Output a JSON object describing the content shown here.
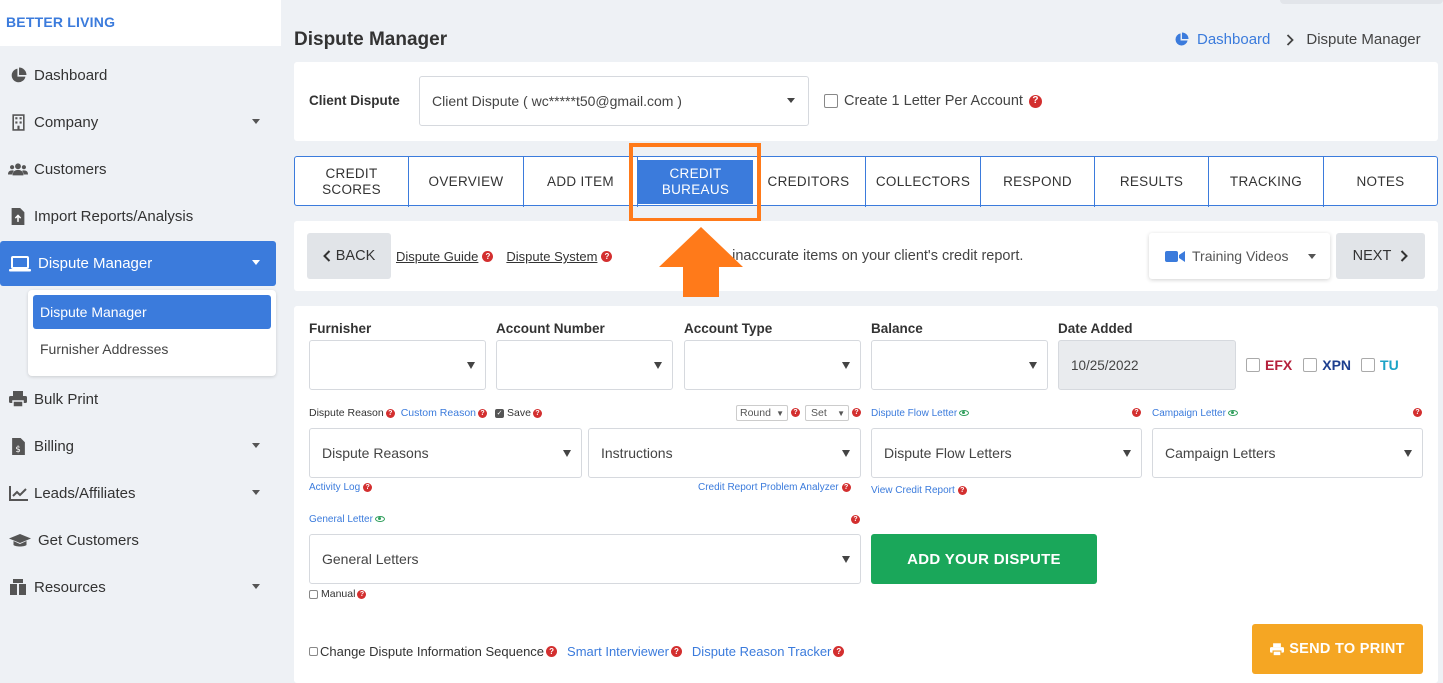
{
  "brand": "BETTER LIVING",
  "nav": [
    {
      "label": "Dashboard",
      "icon": "pie-chart-icon"
    },
    {
      "label": "Company",
      "icon": "building-icon"
    },
    {
      "label": "Customers",
      "icon": "users-icon"
    },
    {
      "label": "Import Reports/Analysis",
      "icon": "file-import-icon"
    },
    {
      "label": "Dispute Manager",
      "icon": "laptop-icon"
    },
    {
      "label": "Bulk Print",
      "icon": "printer-icon"
    },
    {
      "label": "Billing",
      "icon": "invoice-icon"
    },
    {
      "label": "Leads/Affiliates",
      "icon": "chart-line-icon"
    },
    {
      "label": "Get Customers",
      "icon": "graduation-cap-icon"
    },
    {
      "label": "Resources",
      "icon": "box-icon"
    }
  ],
  "submenu": [
    "Dispute Manager",
    "Furnisher Addresses"
  ],
  "page": {
    "title": "Dispute Manager",
    "breadcrumb": {
      "home": "Dashboard",
      "current": "Dispute Manager"
    }
  },
  "client": {
    "label": "Client Dispute",
    "value": "Client Dispute ( wc*****t50@gmail.com )",
    "one_letter": "Create 1 Letter Per Account"
  },
  "tabs": [
    {
      "l1": "CREDIT",
      "l2": "SCORES"
    },
    {
      "l1": "OVERVIEW",
      "l2": ""
    },
    {
      "l1": "ADD ITEM",
      "l2": ""
    },
    {
      "l1": "CREDIT",
      "l2": "BUREAUS"
    },
    {
      "l1": "CREDITORS",
      "l2": ""
    },
    {
      "l1": "COLLECTORS",
      "l2": ""
    },
    {
      "l1": "RESPOND",
      "l2": ""
    },
    {
      "l1": "RESULTS",
      "l2": ""
    },
    {
      "l1": "TRACKING",
      "l2": ""
    },
    {
      "l1": "NOTES",
      "l2": ""
    }
  ],
  "toolbar": {
    "back": "BACK",
    "guide": "Dispute Guide",
    "system": "Dispute System",
    "message": "e inaccurate items on your client's credit report.",
    "training": "Training Videos",
    "next": "NEXT"
  },
  "form": {
    "furnisher": "Furnisher",
    "account_number": "Account Number",
    "account_type": "Account Type",
    "balance": "Balance",
    "date_added": "Date Added",
    "date_value": "10/25/2022",
    "efx": "EFX",
    "xpn": "XPN",
    "tu": "TU",
    "dispute_reason": "Dispute Reason",
    "custom_reason": "Custom Reason",
    "save": "Save",
    "round": "Round",
    "set": "Set",
    "dispute_flow_letter": "Dispute Flow Letter",
    "campaign_letter": "Campaign Letter",
    "dispute_reasons": "Dispute Reasons",
    "instructions": "Instructions",
    "dispute_flow_letters": "Dispute Flow Letters",
    "campaign_letters": "Campaign Letters",
    "activity_log": "Activity Log",
    "cr_analyzer": "Credit Report Problem Analyzer",
    "view_report": "View Credit Report",
    "general_letter": "General Letter",
    "general_letters": "General Letters",
    "add_dispute": "ADD YOUR DISPUTE",
    "manual": "Manual",
    "change_seq": "Change Dispute Information Sequence",
    "smart": "Smart Interviewer",
    "tracker": "Dispute Reason Tracker",
    "send_print": "SEND TO PRINT"
  },
  "colors": {
    "accent": "#3b7bdc",
    "highlight": "#ff7a1a",
    "green": "#1aa75a",
    "orange": "#f5a623",
    "efx": "#b5213c",
    "xpn": "#1d3f8f",
    "tu": "#1ba3c6"
  }
}
